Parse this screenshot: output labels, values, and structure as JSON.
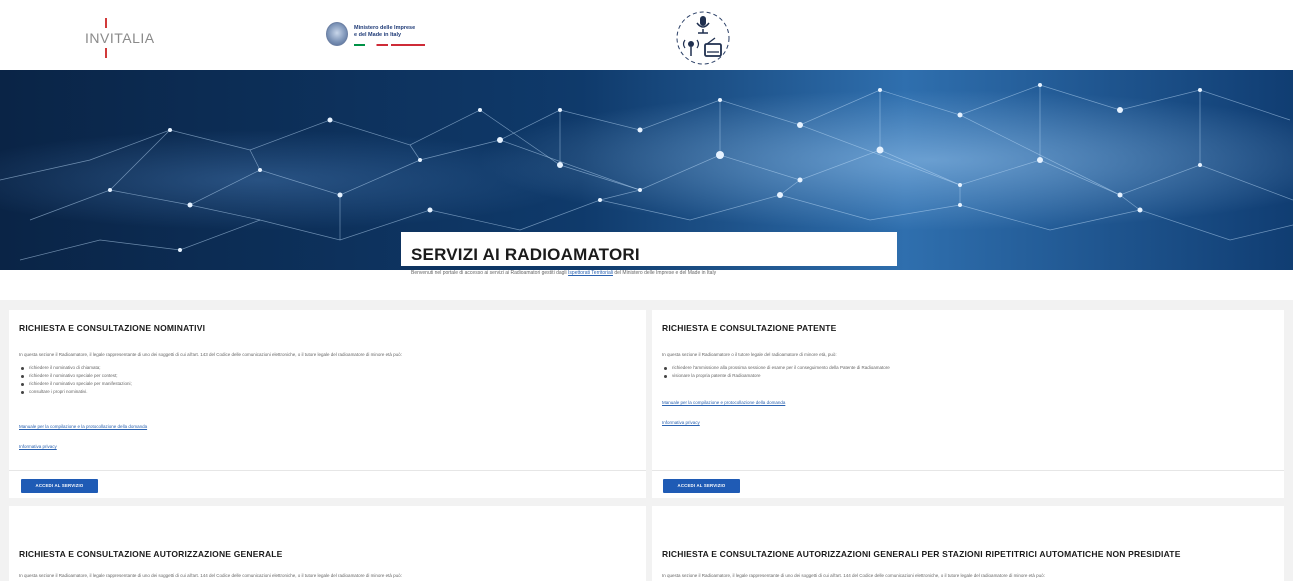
{
  "header": {
    "invitalia_logo": "INVITALIA",
    "ministry_line1": "Ministero delle Imprese",
    "ministry_line2": "e del Made in Italy"
  },
  "hero": {
    "title": "SERVIZI AI RADIOAMATORI",
    "subtitle_before": "Benvenuti nel portale di accesso ai servizi ai Radioamatori gestiti dagli",
    "subtitle_link": "Ispettorati Territoriali",
    "subtitle_after": "del Ministero delle Imprese e del Made in Italy"
  },
  "cards": [
    {
      "title": "RICHIESTA E CONSULTAZIONE NOMINATIVI",
      "intro": "In questa sezione il Radioamatore, il legale rappresentante di uno dei soggetti di cui all'art. 143 del Codice delle comunicazioni elettroniche, o il tutore legale del radioamatore di minore età può:",
      "bullets": [
        "richiedere il nominativo di chiamata;",
        "richiedere il nominativo speciale per contest;",
        "richiedere il nominativo speciale per manifestazioni;",
        "consultare i propri nominativi."
      ],
      "link1": "Manuale per la compilazione e la protocollazione della domanda",
      "link2": "Informativa privacy",
      "button": "ACCEDI AL SERVIZIO"
    },
    {
      "title": "RICHIESTA E CONSULTAZIONE PATENTE",
      "intro": "In questa sezione il Radioamatore o il tutore legale del radioamatore di minore età, può:",
      "bullets": [
        "richiedere l'ammissione alla prossima sessione di esame per il conseguimento della Patente di Radioamatore",
        "visionare la propria patente di Radioamatore"
      ],
      "link1": "Manuale per la compilazione e protocollazione della domanda",
      "link2": "Informativa privacy",
      "button": "ACCEDI AL SERVIZIO"
    },
    {
      "title": "RICHIESTA E CONSULTAZIONE AUTORIZZAZIONE GENERALE",
      "intro": "In questa sezione il Radioamatore, il legale rappresentante di uno dei soggetti di cui all'art. 144 del Codice delle comunicazioni elettroniche, o il tutore legale del radioamatore di minore età può:"
    },
    {
      "title": "RICHIESTA E CONSULTAZIONE AUTORIZZAZIONI GENERALI PER STAZIONI RIPETITRICI AUTOMATICHE NON PRESIDIATE",
      "intro": "In questa sezione il Radioamatore, il legale rappresentante di uno dei soggetti di cui all'art. 144 del Codice delle comunicazioni elettroniche, o il tutore legale del radioamatore di minore età può:"
    }
  ],
  "colors": {
    "button": "#1f5bb5",
    "link": "#2a62b0",
    "hero_bg": "#0b2c52"
  }
}
